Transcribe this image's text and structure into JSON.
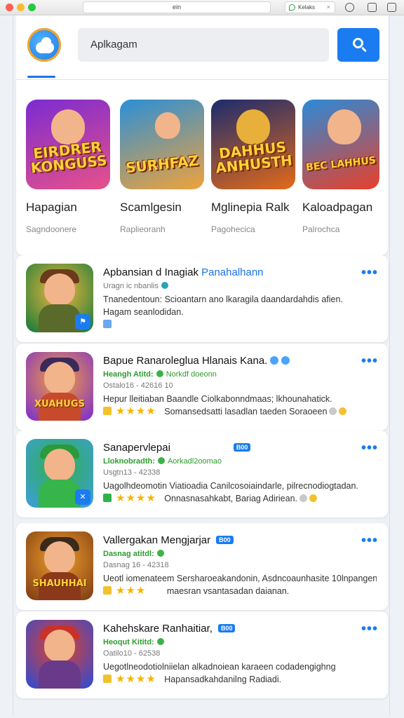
{
  "browser": {
    "url_text": "ein",
    "extension_label": "Kelaks"
  },
  "header": {
    "search_placeholder": "Aplkagam"
  },
  "featured": [
    {
      "title": "Hapagian",
      "subtitle": "Sagndoonere",
      "art_text": "EIRDRER KONGUSS",
      "colors": [
        "#7b2bd1",
        "#e8518a"
      ]
    },
    {
      "title": "Scamlgesin",
      "subtitle": "Raplieoranh",
      "art_text": "SURHFAZ",
      "colors": [
        "#2a8fd8",
        "#f0a23b"
      ]
    },
    {
      "title": "Mglinepia Ralk",
      "subtitle": "Pagohecica",
      "art_text": "DAHHUS ANHUSTH",
      "colors": [
        "#1b2b6e",
        "#e36a1a"
      ]
    },
    {
      "title": "Kaloadpagan",
      "subtitle": "Palrochca",
      "art_text": "BEC LAHHUS",
      "colors": [
        "#2b8ad8",
        "#e8402a"
      ]
    }
  ],
  "list": [
    {
      "title": "Apbansian d Inagiak",
      "title_highlight": "Panahalhann",
      "meta_line1": "Uragn ic nbanlis",
      "desc_line1": "Tnanedentoun: Scioantarn ano lkaragila daandardahdis afien.",
      "desc_line2": "Hagam seanlodidan.",
      "colors": [
        "#0f7a3a",
        "#f4b63d"
      ]
    },
    {
      "title": "Bapue Ranaroleglua Hlanais Kana.",
      "meta_green": "Heangh Atitd:",
      "meta_green2": "Norkdf doeonn",
      "meta_line2": "Ostalo16 - 42616 10",
      "desc_line1": "Hepur lleitiaban Baandle Ciolkabonndmaas; lkhounahatick.",
      "desc_line2": "Somansedsatti lasadlan taeden Soraoeen",
      "colors": [
        "#7a2bd1",
        "#f6a13a"
      ],
      "art_text": "XUAHUGS"
    },
    {
      "title": "Sanapervlepai",
      "tag": "B00",
      "meta_green": "Lloknobradth:",
      "meta_green2": "Aorkadl2oomao",
      "meta_line2": "Usgtn13 - 42338",
      "desc_line1": "Uagolhdeomotin Viatioadia Canilcosoiaindarle, pilrecnodiogtadan.",
      "desc_line2": "Onnasnasahkabt, Bariag Adiriean.",
      "colors": [
        "#3e9de0",
        "#2fb14b"
      ]
    },
    {
      "title": "Vallergakan Mengjarjar",
      "tag": "B00",
      "meta_green": "Dasnag atitdl:",
      "meta_line2": "Dasnag 16 - 42318",
      "desc_line1": "Ueotl iomenateem Sersharoeakandonin, Asdncoaunhasite 10lnpangen",
      "desc_line2": "maesran vsantasadan daianan.",
      "colors": [
        "#7a3a14",
        "#f2a02a"
      ],
      "art_text": "SHAUHHAI"
    },
    {
      "title": "Kahehskare Ranhaitiar,",
      "tag": "B00",
      "meta_green": "Heoqut Kititd:",
      "meta_line2": "Oatilo10 - 62538",
      "desc_line1": "Uegotlneodotiolniielan alkadnoiean karaeen codadengighng",
      "desc_line2": "Hapansadkahdanilng Radiadi.",
      "colors": [
        "#2a4bd8",
        "#e3402a"
      ]
    }
  ],
  "accent_color": "#1a7cf0"
}
